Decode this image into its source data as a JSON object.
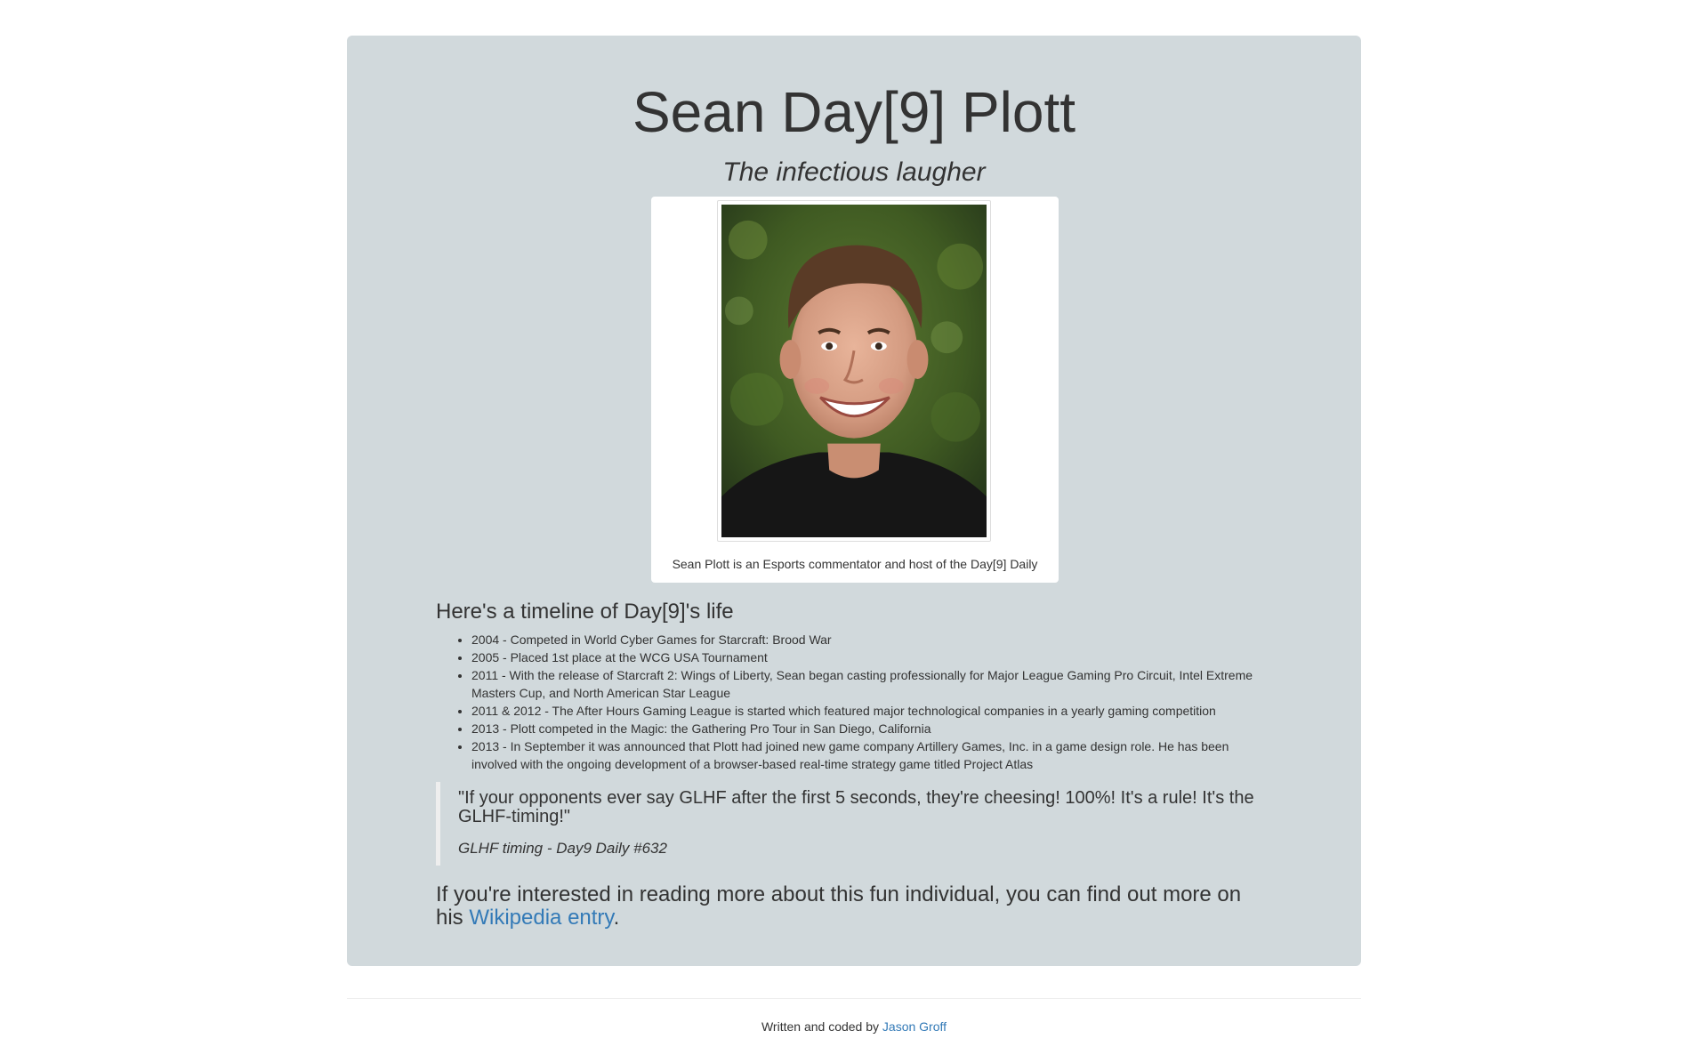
{
  "header": {
    "title": "Sean Day[9] Plott",
    "subtitle": "The infectious laugher"
  },
  "figure": {
    "caption": "Sean Plott is an Esports commentator and host of the Day[9] Daily"
  },
  "timeline": {
    "heading": "Here's a timeline of Day[9]'s life",
    "items": [
      "2004 - Competed in World Cyber Games for Starcraft: Brood War",
      "2005 - Placed 1st place at the WCG USA Tournament",
      "2011 - With the release of Starcraft 2: Wings of Liberty, Sean began casting professionally for Major League Gaming Pro Circuit, Intel Extreme Masters Cup, and North American Star League",
      "2011 & 2012 - The After Hours Gaming League is started which featured major technological companies in a yearly gaming competition",
      "2013 - Plott competed in the Magic: the Gathering Pro Tour in San Diego, California",
      "2013 - In September it was announced that Plott had joined new game company Artillery Games, Inc. in a game design role. He has been involved with the ongoing development of a browser-based real-time strategy game titled Project Atlas"
    ]
  },
  "quote": {
    "text": "\"If your opponents ever say GLHF after the first 5 seconds, they're cheesing! 100%! It's a rule! It's the GLHF-timing!\"",
    "source": "GLHF timing - Day9 Daily #632"
  },
  "more_info": {
    "prefix": "If you're interested in reading more about this fun individual, you can find out more on his ",
    "link_text": "Wikipedia entry",
    "suffix": "."
  },
  "footer": {
    "prefix": "Written and coded by ",
    "author_link": "Jason Groff"
  }
}
